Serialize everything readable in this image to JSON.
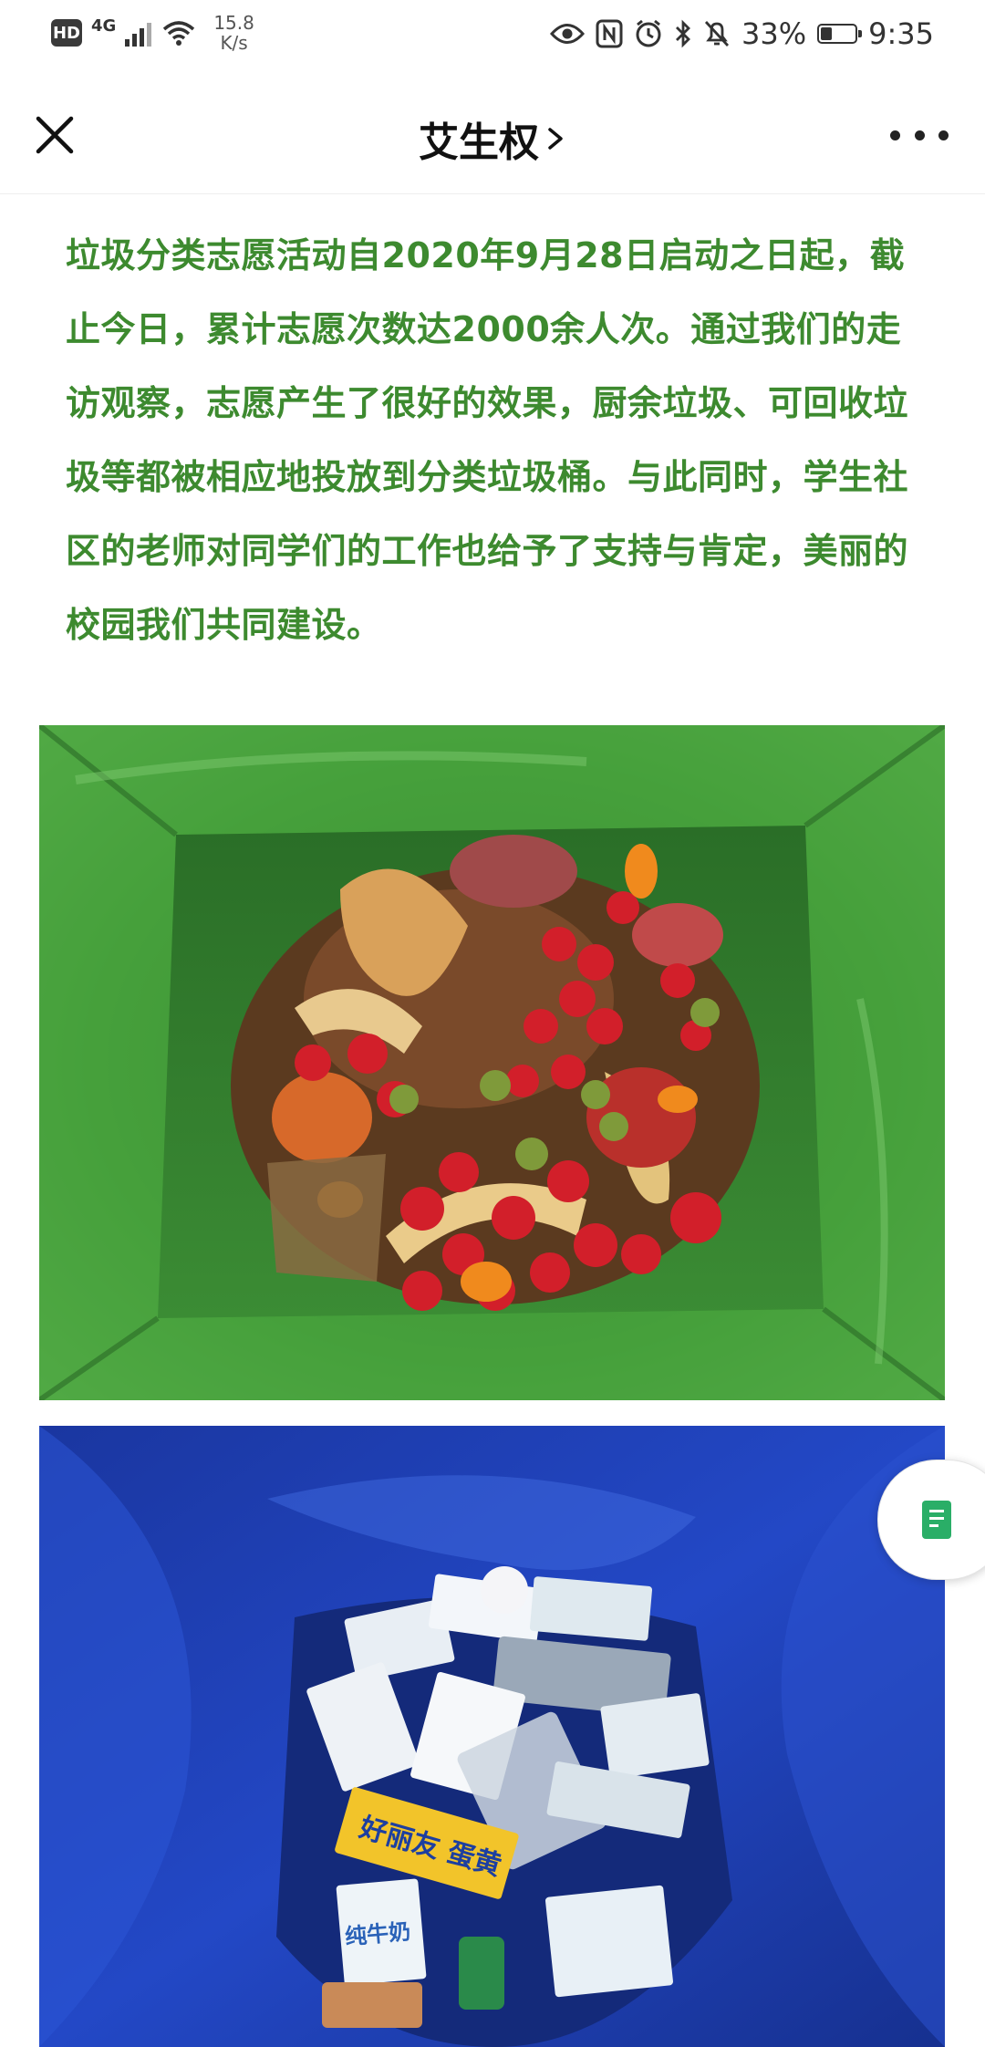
{
  "status_bar": {
    "hd": "HD",
    "network": "4G",
    "speed_value": "15.8",
    "speed_unit": "K/s",
    "battery_percent": "33%",
    "battery_level": 0.33,
    "time": "9:35",
    "icons": [
      "eye-icon",
      "nfc-icon",
      "alarm-icon",
      "bluetooth-icon",
      "mute-bell-icon"
    ]
  },
  "nav": {
    "title": "艾生权",
    "close_icon": "close-icon",
    "chevron_icon": "chevron-right-icon",
    "more_icon": "more-icon"
  },
  "article": {
    "paragraph": "垃圾分类志愿活动自2020年9月28日启动之日起，截止今日，累计志愿次数达2000余人次。通过我们的走访观察，志愿产生了很好的效果，厨余垃圾、可回收垃圾等都被相应地投放到分类垃圾桶。与此同时，学生社区的老师对同学们的工作也给予了支持与肯定，美丽的校园我们共同建设。",
    "text_color": "#3d8a2f"
  },
  "photos": {
    "food_waste_label": "纯牛奶",
    "recycle_label_1": "好丽友",
    "recycle_label_2": "蛋黄",
    "food_bin_color": "#3f9a35",
    "recycle_bin_color": "#1f3fb0"
  },
  "floating_button": {
    "icon": "document-icon",
    "color": "#2aae67"
  }
}
